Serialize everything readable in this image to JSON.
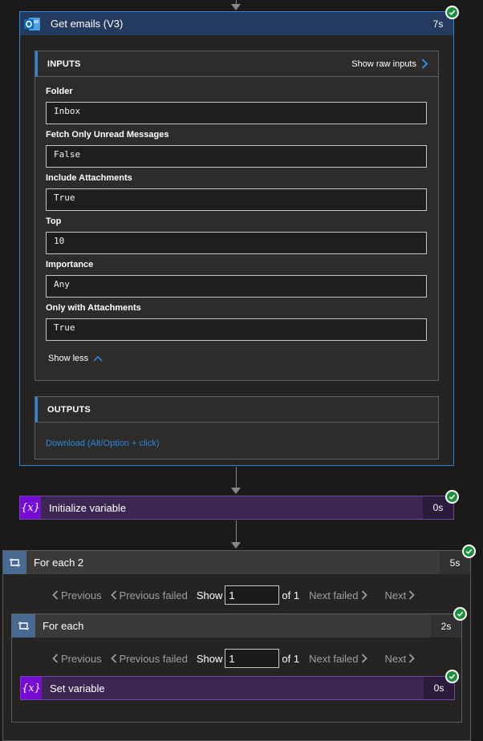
{
  "get_emails": {
    "title": "Get emails (V3)",
    "duration": "7s",
    "inputs_title": "INPUTS",
    "show_raw_inputs": "Show raw inputs",
    "fields": [
      {
        "label": "Folder",
        "value": "Inbox"
      },
      {
        "label": "Fetch Only Unread Messages",
        "value": "False"
      },
      {
        "label": "Include Attachments",
        "value": "True"
      },
      {
        "label": "Top",
        "value": "10"
      },
      {
        "label": "Importance",
        "value": "Any"
      },
      {
        "label": "Only with Attachments",
        "value": "True"
      }
    ],
    "show_less": "Show less",
    "outputs_title": "OUTPUTS",
    "download_link": "Download (Alt/Option + click)"
  },
  "init_variable": {
    "title": "Initialize variable",
    "duration": "0s",
    "icon": "{x}"
  },
  "for_each_2": {
    "title": "For each 2",
    "duration": "5s",
    "pager": {
      "previous": "Previous",
      "previous_failed": "Previous failed",
      "show": "Show",
      "page_value": "1",
      "of": "of 1",
      "next_failed": "Next failed",
      "next": "Next"
    }
  },
  "for_each": {
    "title": "For each",
    "duration": "2s",
    "pager": {
      "previous": "Previous",
      "previous_failed": "Previous failed",
      "show": "Show",
      "page_value": "1",
      "of": "of 1",
      "next_failed": "Next failed",
      "next": "Next"
    }
  },
  "set_variable": {
    "title": "Set variable",
    "duration": "0s",
    "icon": "{x}"
  },
  "colors": {
    "success": "#1a8f3c",
    "link": "#2b88d8",
    "variable_purple": "#770bd6"
  }
}
